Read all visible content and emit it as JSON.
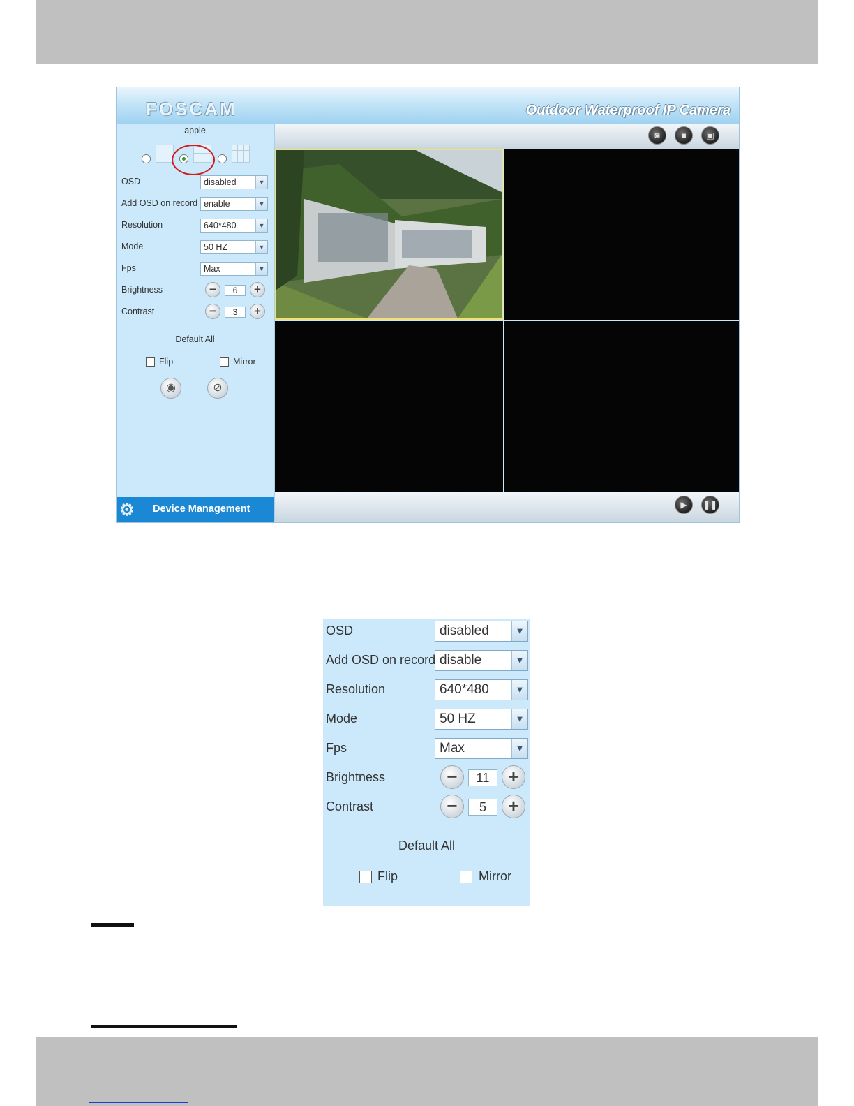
{
  "camera_ui": {
    "logo": "FOSCAM",
    "product_name": "Outdoor Waterproof IP Camera",
    "sidebar": {
      "device_name": "apple",
      "layout_options": [
        "1-view",
        "4-view",
        "9-view"
      ],
      "layout_selected": "4-view",
      "osd_label": "OSD",
      "osd_value": "disabled",
      "add_osd_label": "Add OSD on record",
      "add_osd_value": "enable",
      "resolution_label": "Resolution",
      "resolution_value": "640*480",
      "mode_label": "Mode",
      "mode_value": "50 HZ",
      "fps_label": "Fps",
      "fps_value": "Max",
      "brightness_label": "Brightness",
      "brightness_value": "6",
      "contrast_label": "Contrast",
      "contrast_value": "3",
      "default_all": "Default All",
      "flip_label": "Flip",
      "mirror_label": "Mirror",
      "device_management": "Device Management"
    },
    "toolbar_top_icons": [
      "snapshot-icon",
      "record-icon",
      "fullscreen-icon"
    ],
    "toolbar_bottom_icons": [
      "play-icon",
      "pause-icon"
    ],
    "video_panes": [
      "camera-feed",
      "empty",
      "empty",
      "empty"
    ]
  },
  "zoom_panel": {
    "osd_label": "OSD",
    "osd_value": "disabled",
    "add_osd_label": "Add OSD on record",
    "add_osd_value": "disable",
    "resolution_label": "Resolution",
    "resolution_value": "640*480",
    "mode_label": "Mode",
    "mode_value": "50 HZ",
    "fps_label": "Fps",
    "fps_value": "Max",
    "brightness_label": "Brightness",
    "brightness_value": "11",
    "contrast_label": "Contrast",
    "contrast_value": "5",
    "default_all": "Default All",
    "flip_label": "Flip",
    "mirror_label": "Mirror"
  },
  "colors": {
    "page_band": "#c0c0c0",
    "panel_bg": "#cbe9fa",
    "device_mgmt_bar": "#1b88d6",
    "highlight_circle": "#d41c1c"
  }
}
